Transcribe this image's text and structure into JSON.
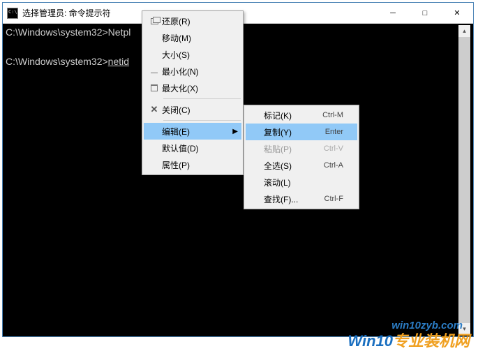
{
  "titlebar": {
    "title": "选择管理员: 命令提示符"
  },
  "winbtns": {
    "min": "─",
    "max": "□",
    "close": "✕"
  },
  "console": {
    "line1_prompt": "C:\\Windows\\system32>",
    "line1_cmd": "Netpl",
    "line2_prompt": "C:\\Windows\\system32>",
    "line2_cmd": "netid"
  },
  "menu1": {
    "restore": "还原(R)",
    "move": "移动(M)",
    "size": "大小(S)",
    "minimize": "最小化(N)",
    "maximize": "最大化(X)",
    "close": "关闭(C)",
    "edit": "编辑(E)",
    "defaults": "默认值(D)",
    "properties": "属性(P)"
  },
  "menu2": {
    "mark": {
      "label": "标记(K)",
      "shortcut": "Ctrl-M"
    },
    "copy": {
      "label": "复制(Y)",
      "shortcut": "Enter"
    },
    "paste": {
      "label": "粘贴(P)",
      "shortcut": "Ctrl-V"
    },
    "selectall": {
      "label": "全选(S)",
      "shortcut": "Ctrl-A"
    },
    "scroll": {
      "label": "滚动(L)",
      "shortcut": ""
    },
    "find": {
      "label": "查找(F)...",
      "shortcut": "Ctrl-F"
    }
  },
  "watermark": {
    "url": "win10zyb.com",
    "brand_a": "Win10",
    "brand_b": "专业装机网"
  }
}
